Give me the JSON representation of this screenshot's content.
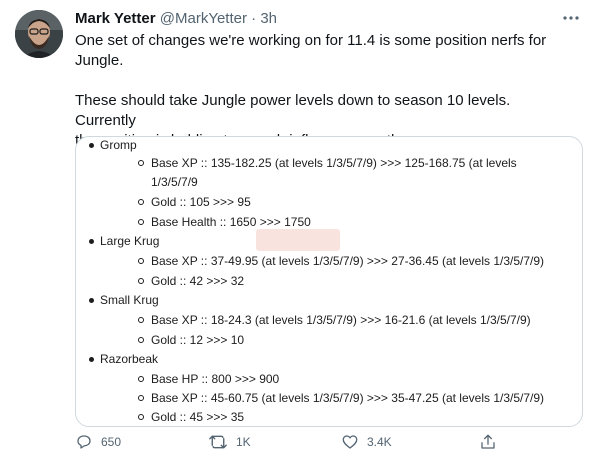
{
  "tweet": {
    "author_name": "Mark Yetter",
    "handle": "@MarkYetter",
    "separator": "·",
    "time": "3h",
    "text": "One set of changes we're working on for 11.4 is some position nerfs for\nJungle.\n\nThese should take Jungle power levels down to season 10 levels. Currently\nthe position is holding too much influence over the game."
  },
  "card": {
    "lines": [
      "Gromp",
      "Base XP :: 135-182.25 (at levels 1/3/5/7/9) >>> 125-168.75 (at levels",
      "1/3/5/7/9",
      "Gold :: 105 >>> 95",
      "Base Health :: 1650 >>> 1750",
      "Large Krug",
      "Base XP :: 37-49.95 (at levels 1/3/5/7/9) >>> 27-36.45 (at levels 1/3/5/7/9)",
      "Gold :: 42 >>> 32",
      "Small Krug",
      "Base XP :: 18-24.3 (at levels 1/3/5/7/9) >>> 16-21.6 (at levels 1/3/5/7/9)",
      "Gold :: 12 >>> 10",
      "Razorbeak",
      "Base HP :: 800 >>> 900",
      "Base XP :: 45-60.75 (at levels 1/3/5/7/9) >>> 35-47.25 (at levels 1/3/5/7/9)",
      "Gold :: 45 >>> 35"
    ]
  },
  "actions": {
    "reply_count": "650",
    "retweet_count": "1K",
    "like_count": "3.4K"
  },
  "icons": {
    "more": "more-icon",
    "reply": "reply-icon",
    "retweet": "retweet-icon",
    "like": "like-icon",
    "share": "share-icon"
  },
  "colors": {
    "text": "#0f1419",
    "secondary": "#536471",
    "border": "#cfd9de"
  }
}
